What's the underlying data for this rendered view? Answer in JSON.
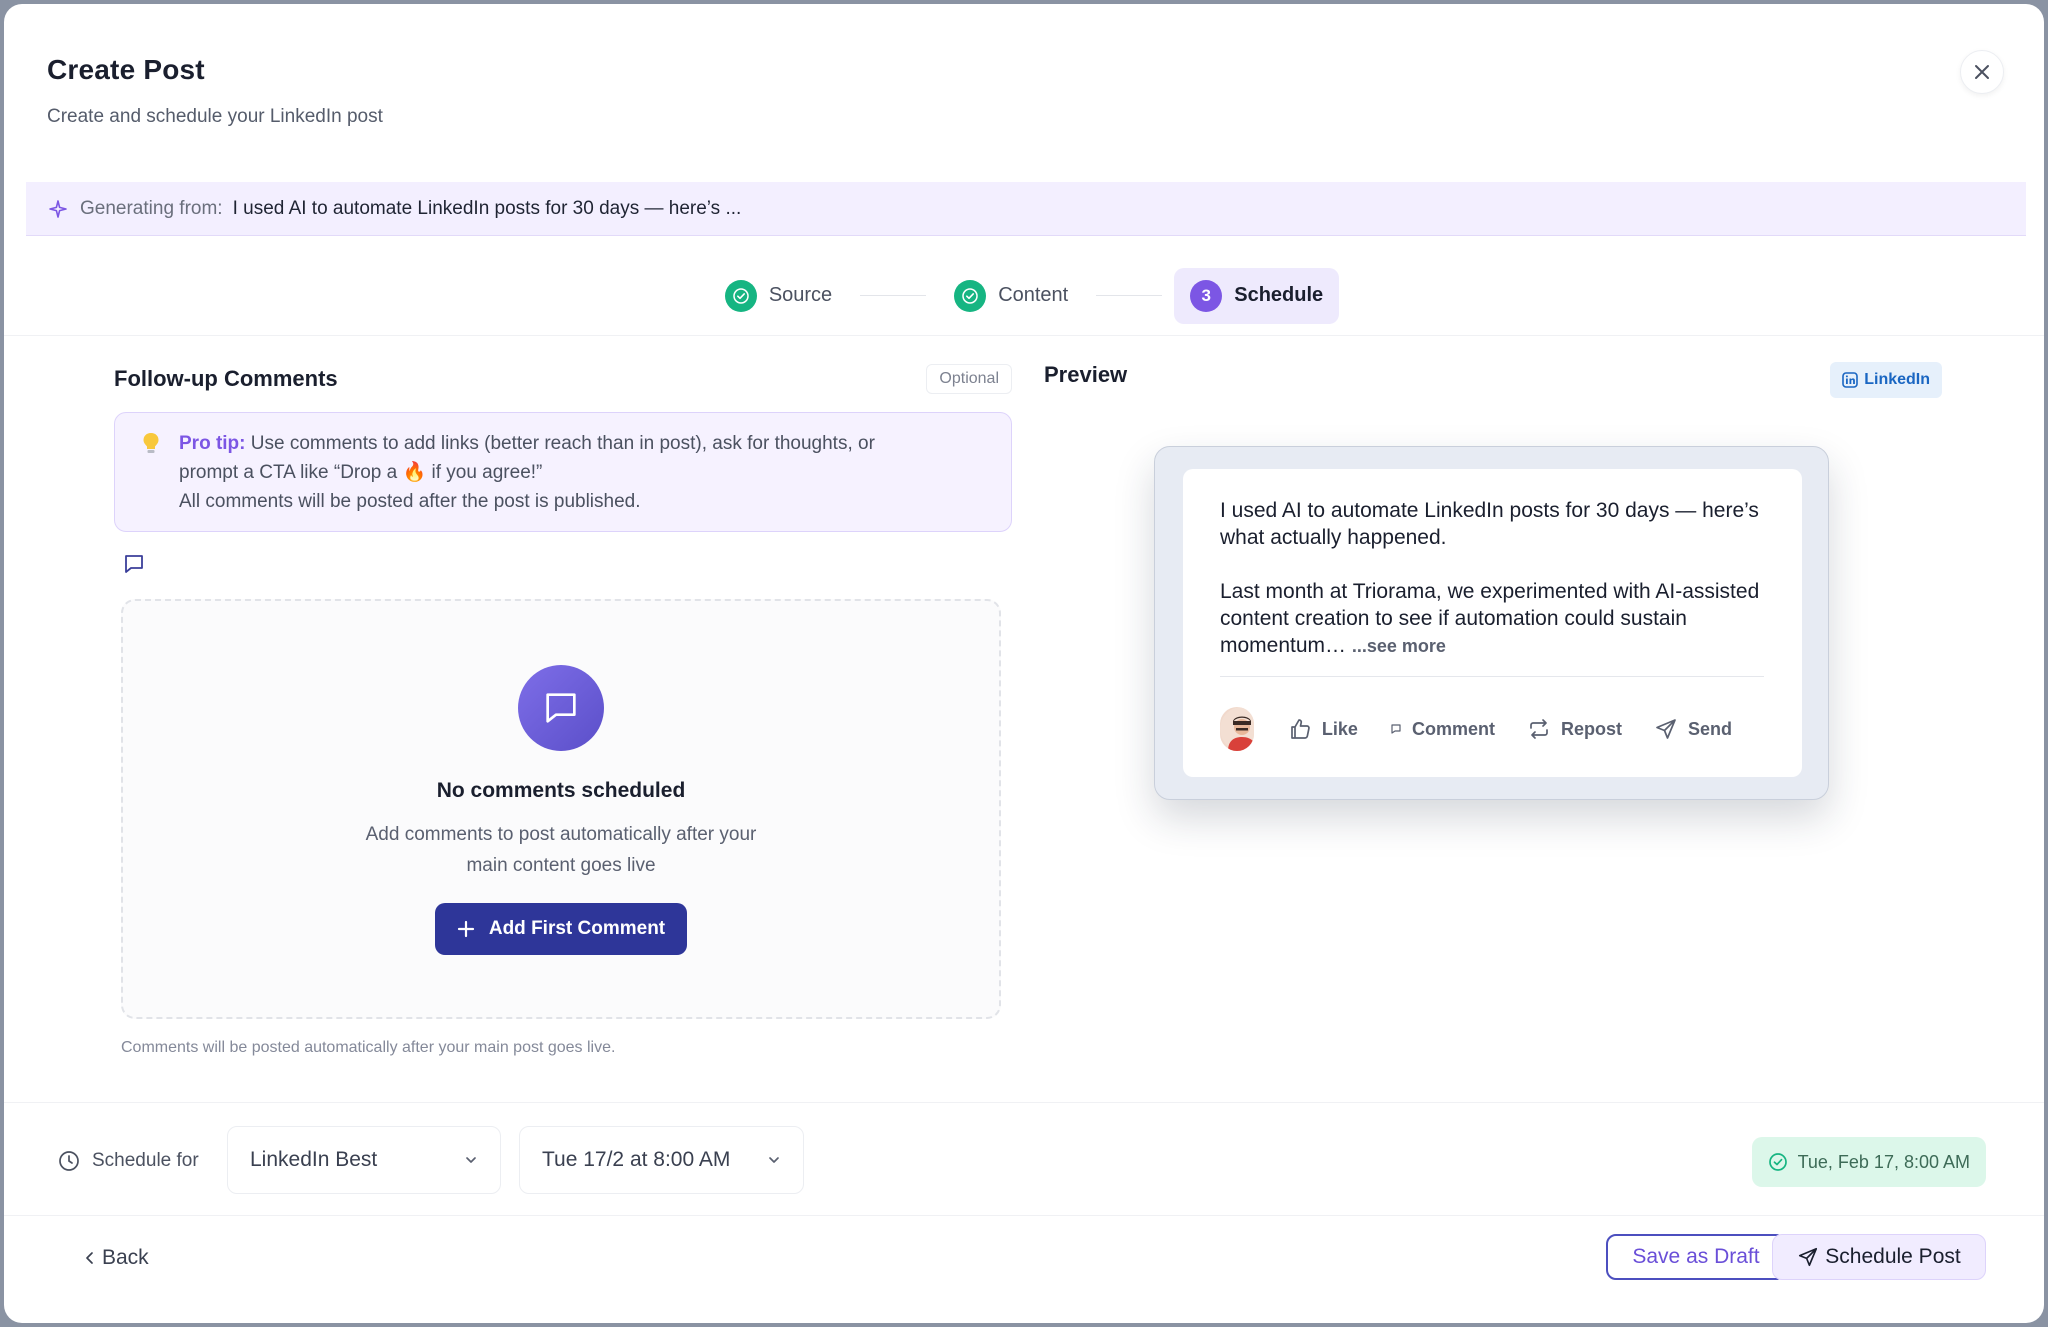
{
  "header": {
    "title": "Create Post",
    "subtitle": "Create and schedule your LinkedIn post"
  },
  "generating": {
    "label": "Generating from:",
    "text": "I used AI to automate LinkedIn posts for 30 days — here’s ..."
  },
  "stepper": {
    "steps": [
      {
        "label": "Source",
        "status": "done"
      },
      {
        "label": "Content",
        "status": "done"
      },
      {
        "label": "Schedule",
        "status": "active",
        "number": "3"
      }
    ]
  },
  "comments": {
    "title": "Follow-up Comments",
    "optional_label": "Optional",
    "tip_title": "Pro tip:",
    "tip_line1": "Use comments to add links (better reach than in post), ask for thoughts, or",
    "tip_line2a": "prompt a CTA like “Drop a",
    "tip_emoji": "🔥",
    "tip_line2b": "if you agree!”",
    "tip_line3": "All comments will be posted after the post is published.",
    "empty_title": "No comments scheduled",
    "empty_desc": "Add comments to post automatically after your main content goes live",
    "add_button": "Add First Comment",
    "footnote": "Comments will be posted automatically after your main post goes live."
  },
  "preview": {
    "title": "Preview",
    "badge": "LinkedIn",
    "post_line1": "I used AI to automate LinkedIn posts for 30 days — here’s what actually happened.",
    "post_line2": "Last month at Triorama, we experimented with AI-assisted content creation to see if automation could sustain momentum…",
    "see_more": "...see more",
    "actions": {
      "like": "Like",
      "comment": "Comment",
      "repost": "Repost",
      "send": "Send"
    }
  },
  "schedule": {
    "label": "Schedule for",
    "slot": "LinkedIn Best",
    "time": "Tue 17/2 at 8:00 AM",
    "badge": "Tue, Feb 17, 8:00 AM"
  },
  "footer": {
    "back": "Back",
    "save_draft": "Save as Draft",
    "schedule_post": "Schedule Post"
  },
  "colors": {
    "accent": "#7c56e4",
    "primary_button": "#2e3699",
    "success": "#16b582",
    "linkedin": "#1a66c2"
  }
}
